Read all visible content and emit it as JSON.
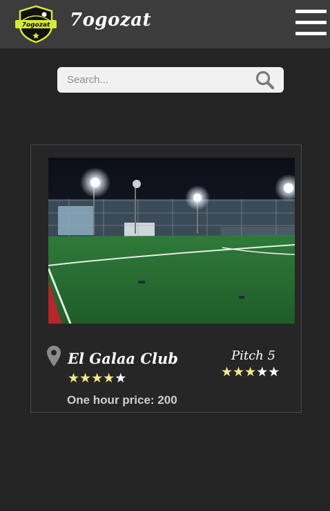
{
  "app": {
    "title": "7ogozat",
    "logo_text": "7ogozat",
    "logo_icon": "football-shield-logo",
    "menu_icon": "hamburger-menu-icon"
  },
  "search": {
    "placeholder": "Search...",
    "value": "",
    "icon": "search-icon"
  },
  "club_card": {
    "name": "El Galaa Club",
    "club_rating": 4,
    "club_rating_max": 5,
    "pitch_label": "Pitch 5",
    "pitch_rating": 3,
    "pitch_rating_max": 5,
    "price_text": "One hour price: 200",
    "location_icon": "map-pin-icon",
    "image": "floodlit-artificial-football-pitch-at-night"
  },
  "colors": {
    "header_bg": "#3c3c3c",
    "page_bg": "#242424",
    "star_on": "#f5e98c",
    "star_off": "#ffffff",
    "logo_accent": "#d7e93a"
  }
}
